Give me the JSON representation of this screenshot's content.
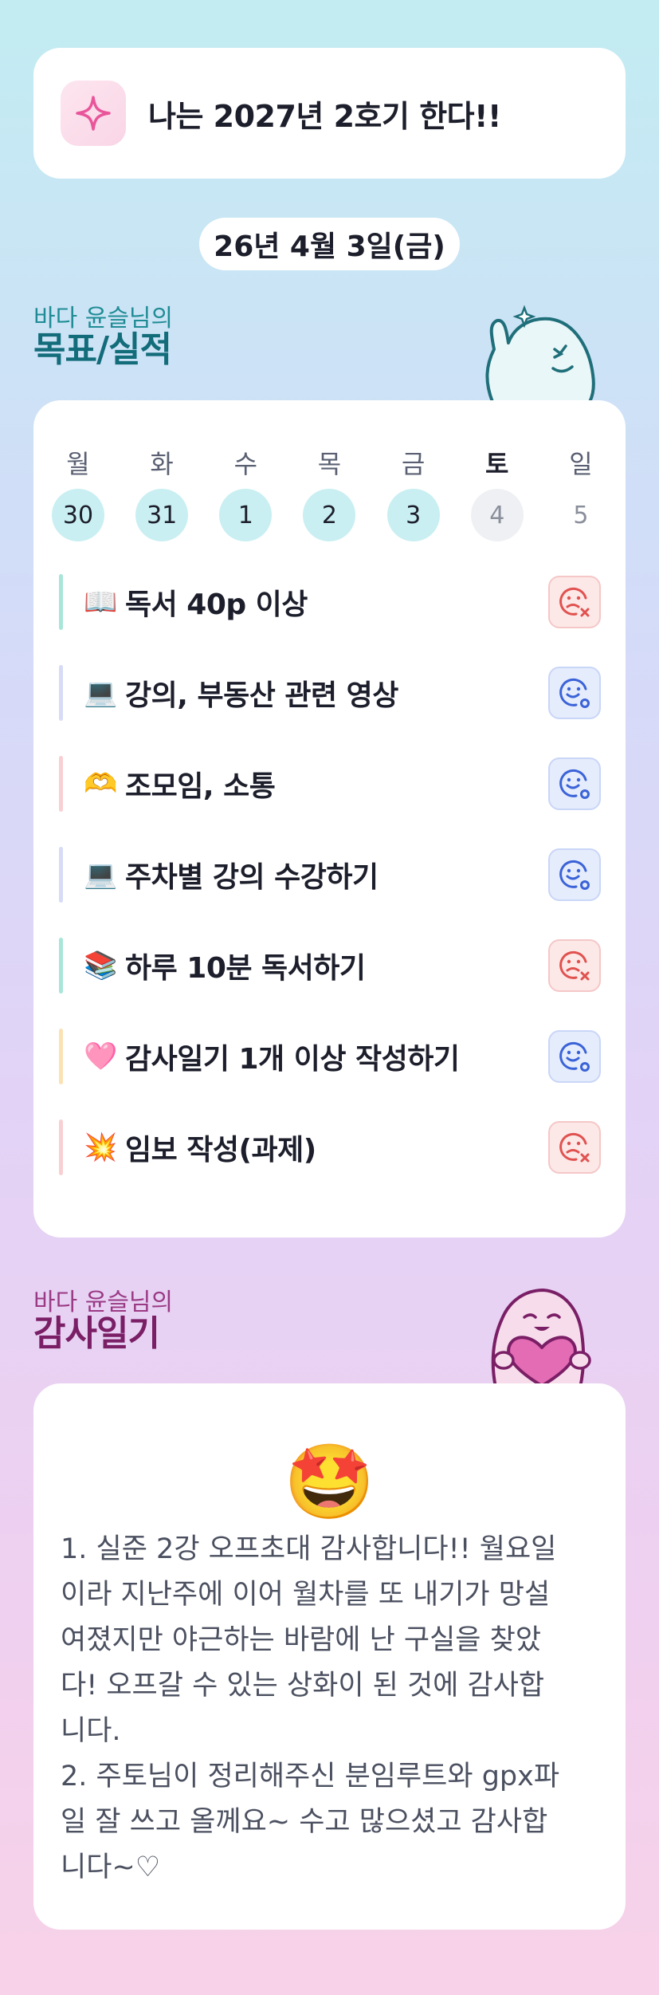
{
  "goal_banner": {
    "text": "나는 2027년 2호기 한다!!",
    "icon": "sparkle-icon"
  },
  "date": "26년 4월 3일(금)",
  "goals_section": {
    "subtitle": "바다 윤슬님의",
    "title": "목표/실적"
  },
  "week": [
    {
      "day": "월",
      "num": "30",
      "state": "done"
    },
    {
      "day": "화",
      "num": "31",
      "state": "done"
    },
    {
      "day": "수",
      "num": "1",
      "state": "done"
    },
    {
      "day": "목",
      "num": "2",
      "state": "done"
    },
    {
      "day": "금",
      "num": "3",
      "state": "done"
    },
    {
      "day": "토",
      "num": "4",
      "state": "today"
    },
    {
      "day": "일",
      "num": "5",
      "state": "future"
    }
  ],
  "tasks": [
    {
      "emoji": "📖",
      "label": "독서 40p 이상",
      "status": "fail",
      "bar_color": "#a9e5d8"
    },
    {
      "emoji": "💻",
      "label": "강의, 부동산 관련 영상",
      "status": "ok",
      "bar_color": "#d6dcf6"
    },
    {
      "emoji": "🫶",
      "label": "조모임, 소통",
      "status": "ok",
      "bar_color": "#f9d0d2"
    },
    {
      "emoji": "💻",
      "label": "주차별 강의 수강하기",
      "status": "ok",
      "bar_color": "#d6dcf6"
    },
    {
      "emoji": "📚",
      "label": "하루 10분 독서하기",
      "status": "fail",
      "bar_color": "#a9e5d8"
    },
    {
      "emoji": "🩷",
      "label": "감사일기 1개 이상 작성하기",
      "status": "ok",
      "bar_color": "#fbe2b4"
    },
    {
      "emoji": "💥",
      "label": "임보 작성(과제)",
      "status": "fail",
      "bar_color": "#f9d0d2"
    }
  ],
  "gratitude_section": {
    "subtitle": "바다 윤슬님의",
    "title": "감사일기"
  },
  "gratitude": {
    "emoji": "🤩",
    "text": "1. 실준 2강 오프초대 감사합니다!! 월요일\n이라 지난주에 이어 월차를 또 내기가 망설\n여졌지만 야근하는 바람에 난 구실을 찾았\n다! 오프갈 수 있는 상화이 된 것에 감사합\n니다.\n2. 주토님이 정리해주신 분임루트와 gpx파\n일 잘 쓰고 올께요~ 수고 많으셨고 감사합\n니다~♡"
  },
  "colors": {
    "ok": "#3b63d8",
    "fail": "#e0524f",
    "teal_title": "#126c7a",
    "plum_title": "#7a1f66"
  }
}
